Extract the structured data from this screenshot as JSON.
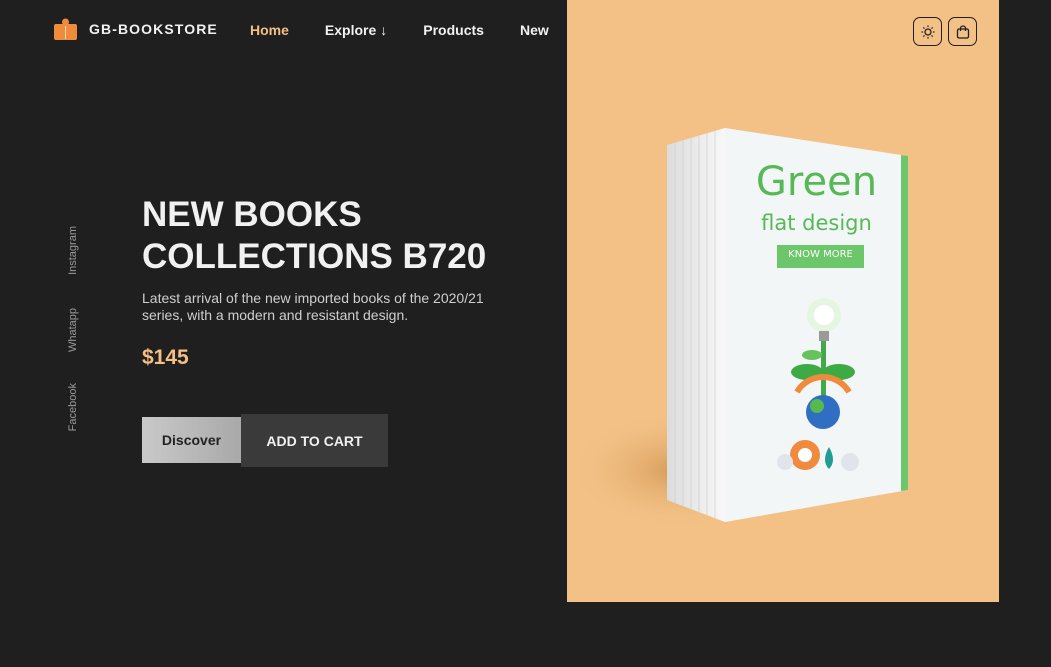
{
  "brand": {
    "name": "GB-BOOKSTORE",
    "icon": "open-book-icon"
  },
  "nav": {
    "items": [
      {
        "label": "Home",
        "active": true
      },
      {
        "label": "Explore",
        "dropdown": true
      },
      {
        "label": "Products"
      },
      {
        "label": "New"
      }
    ]
  },
  "header_actions": {
    "theme_icon": "sun-icon",
    "cart_icon": "shopping-bag-icon"
  },
  "social": [
    "Instagram",
    "Whatapp",
    "Facebook"
  ],
  "hero": {
    "title_line1": "NEW BOOKS",
    "title_line2": "COLLECTIONS B720",
    "description": "Latest arrival of the new imported books of the 2020/21 series, with a modern and resistant design.",
    "price": "$145",
    "discover_label": "Discover",
    "cart_label": "ADD TO CART"
  },
  "book_cover": {
    "title": "Green",
    "subtitle": "flat design",
    "button": "KNOW MORE"
  },
  "colors": {
    "background": "#1f1f1f",
    "accent": "#f3bf83",
    "panel": "#f3c186",
    "cover_green": "#57b955"
  }
}
